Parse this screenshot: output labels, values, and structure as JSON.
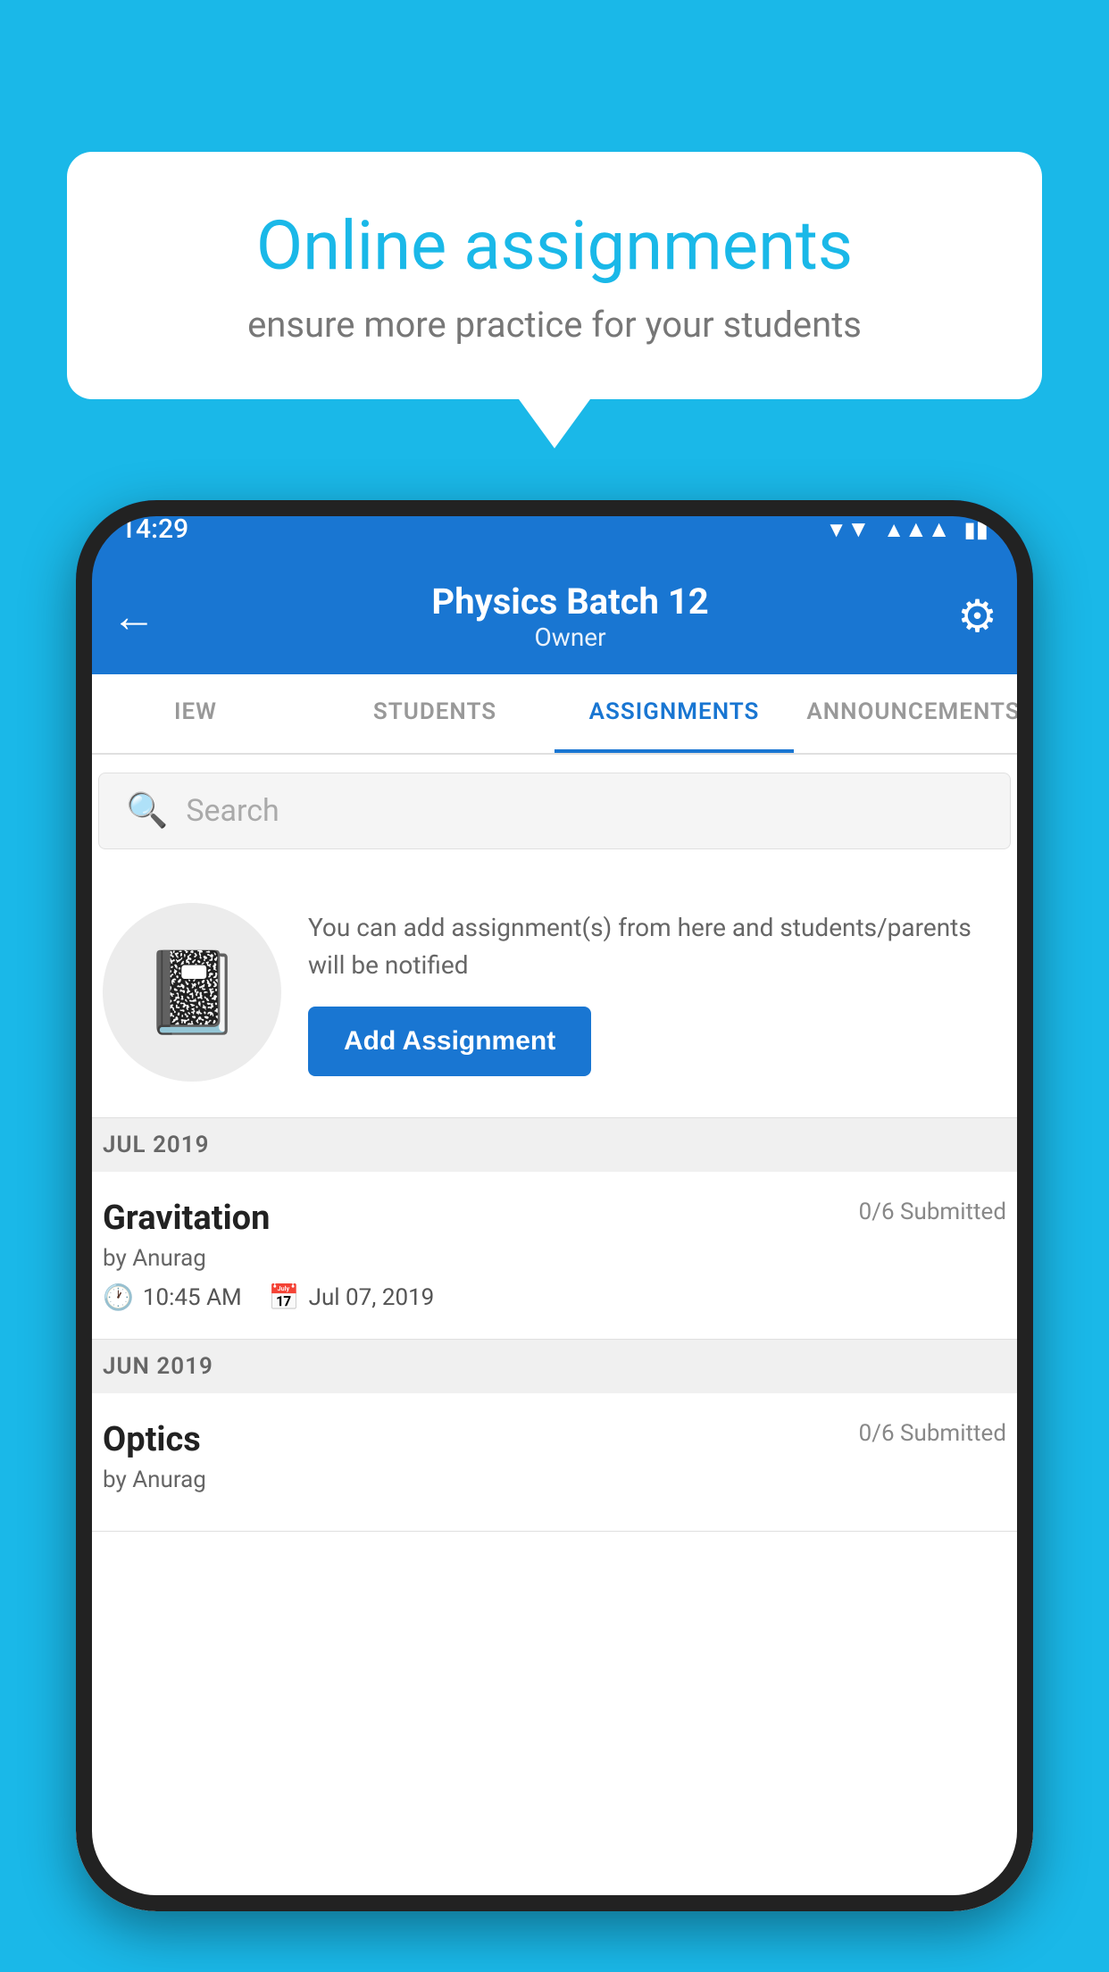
{
  "background_color": "#1ab8e8",
  "speech_bubble": {
    "title": "Online assignments",
    "subtitle": "ensure more practice for your students"
  },
  "phone": {
    "status_bar": {
      "time": "14:29"
    },
    "app_bar": {
      "title": "Physics Batch 12",
      "subtitle": "Owner",
      "back_icon": "←",
      "settings_icon": "⚙"
    },
    "tabs": [
      {
        "label": "IEW",
        "active": false
      },
      {
        "label": "STUDENTS",
        "active": false
      },
      {
        "label": "ASSIGNMENTS",
        "active": true
      },
      {
        "label": "ANNOUNCEMENTS",
        "active": false
      }
    ],
    "search": {
      "placeholder": "Search"
    },
    "empty_state": {
      "description": "You can add assignment(s) from here and students/parents will be notified",
      "button_label": "Add Assignment"
    },
    "sections": [
      {
        "label": "JUL 2019",
        "assignments": [
          {
            "title": "Gravitation",
            "submitted": "0/6 Submitted",
            "by": "by Anurag",
            "time": "10:45 AM",
            "date": "Jul 07, 2019"
          }
        ]
      },
      {
        "label": "JUN 2019",
        "assignments": [
          {
            "title": "Optics",
            "submitted": "0/6 Submitted",
            "by": "by Anurag",
            "time": "",
            "date": ""
          }
        ]
      }
    ]
  }
}
